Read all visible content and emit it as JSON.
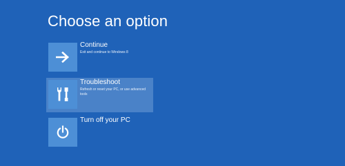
{
  "page": {
    "title": "Choose an option",
    "background_color": "#1f62b8",
    "tile_color": "#4d8fd6",
    "selected_color": "#4a82c8"
  },
  "options": [
    {
      "label": "Continue",
      "description": "Exit and continue to Windows 8",
      "icon": "arrow-right-icon",
      "selected": false
    },
    {
      "label": "Troubleshoot",
      "description": "Refresh or reset your PC, or use advanced tools",
      "icon": "tools-icon",
      "selected": true
    },
    {
      "label": "Turn off your PC",
      "description": "",
      "icon": "power-icon",
      "selected": false
    }
  ]
}
